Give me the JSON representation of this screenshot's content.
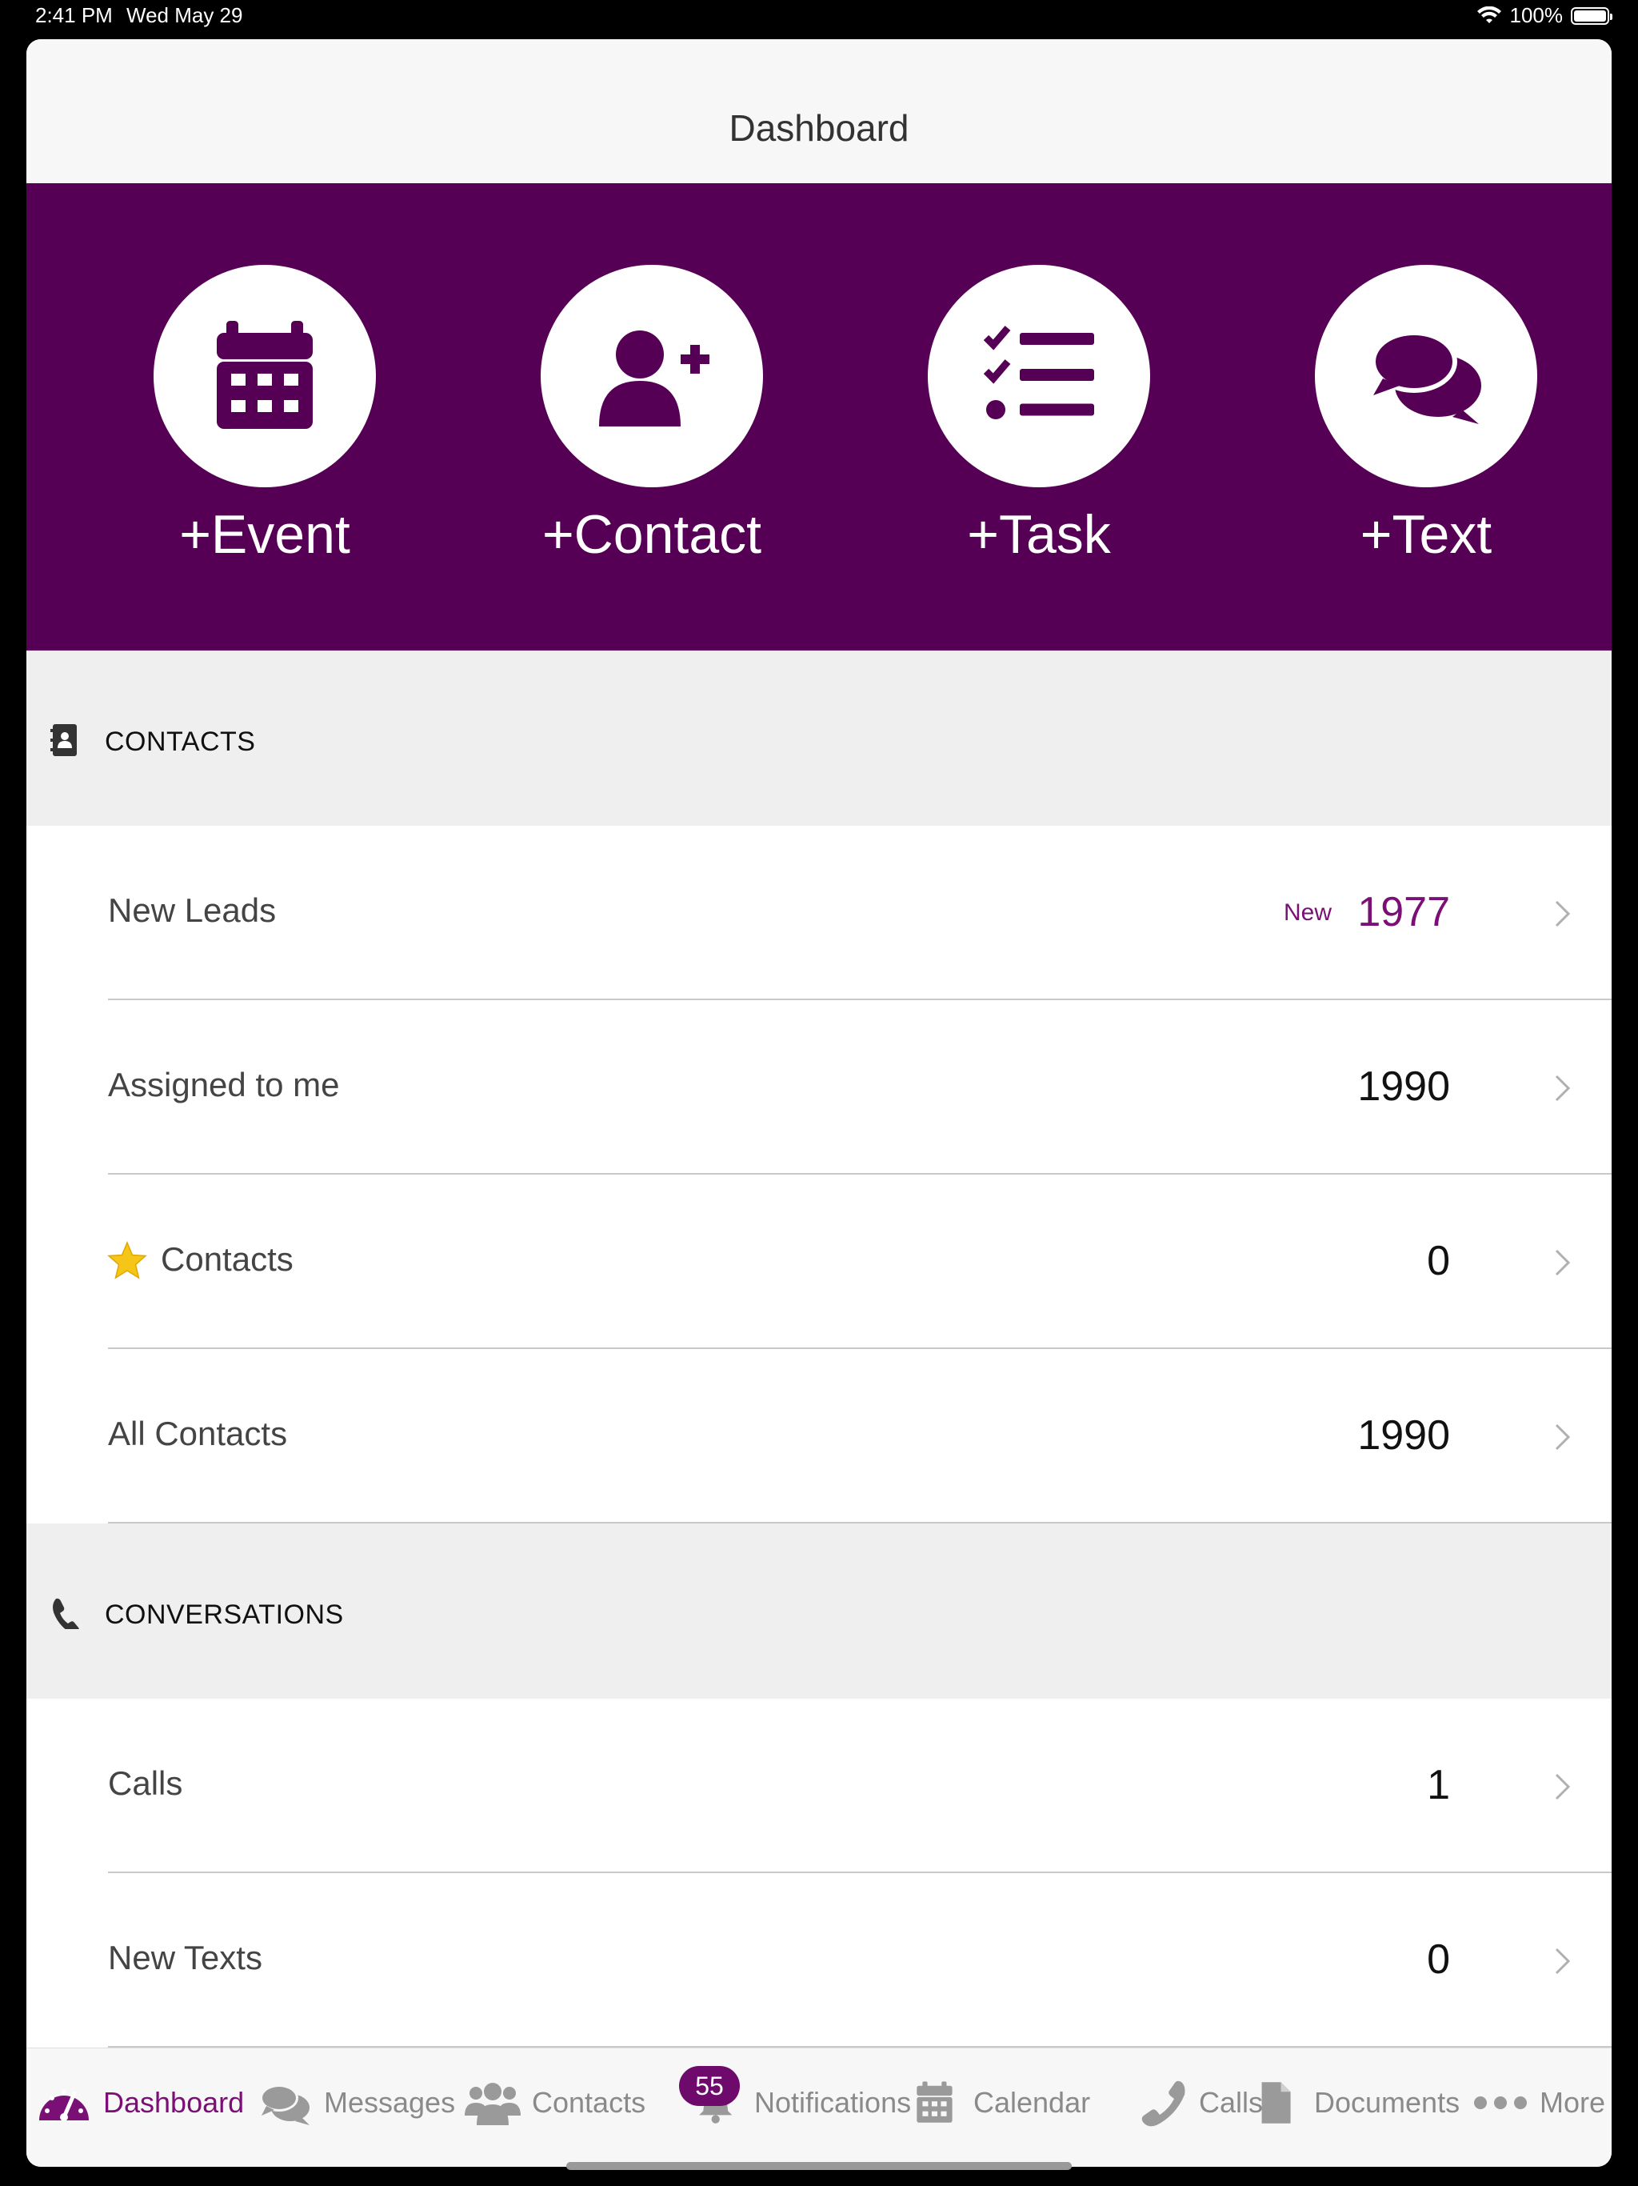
{
  "status_bar": {
    "time": "2:41 PM",
    "date": "Wed May 29",
    "battery": "100%"
  },
  "navbar": {
    "title": "Dashboard"
  },
  "quick_actions": [
    {
      "label": "+Event",
      "icon": "calendar-icon"
    },
    {
      "label": "+Contact",
      "icon": "user-plus-icon"
    },
    {
      "label": "+Task",
      "icon": "task-list-icon"
    },
    {
      "label": "+Text",
      "icon": "chat-bubbles-icon"
    }
  ],
  "sections": {
    "contacts": {
      "title": "CONTACTS",
      "icon": "address-book-icon",
      "rows": [
        {
          "label": "New Leads",
          "new_badge": "New",
          "count": "1977"
        },
        {
          "label": "Assigned to me",
          "count": "1990"
        },
        {
          "label": "Contacts",
          "count": "0",
          "icon": "star-icon"
        },
        {
          "label": "All Contacts",
          "count": "1990"
        }
      ]
    },
    "conversations": {
      "title": "CONVERSATIONS",
      "icon": "phone-icon",
      "rows": [
        {
          "label": "Calls",
          "count": "1"
        },
        {
          "label": "New Texts",
          "count": "0"
        }
      ]
    }
  },
  "tab_bar": {
    "items": [
      {
        "label": "Dashboard",
        "icon": "speedometer-icon",
        "active": true
      },
      {
        "label": "Messages",
        "icon": "messages-icon"
      },
      {
        "label": "Contacts",
        "icon": "people-icon"
      },
      {
        "label": "Notifications",
        "icon": "bell-icon",
        "badge": "55"
      },
      {
        "label": "Calendar",
        "icon": "calendar-icon"
      },
      {
        "label": "Calls",
        "icon": "phone-icon"
      },
      {
        "label": "Documents",
        "icon": "document-icon"
      },
      {
        "label": "More",
        "icon": "more-dots-icon"
      }
    ]
  },
  "colors": {
    "brand": "#560055",
    "accent": "#7a1075",
    "inactive": "#8a8a8a",
    "star": "#f5c518"
  }
}
